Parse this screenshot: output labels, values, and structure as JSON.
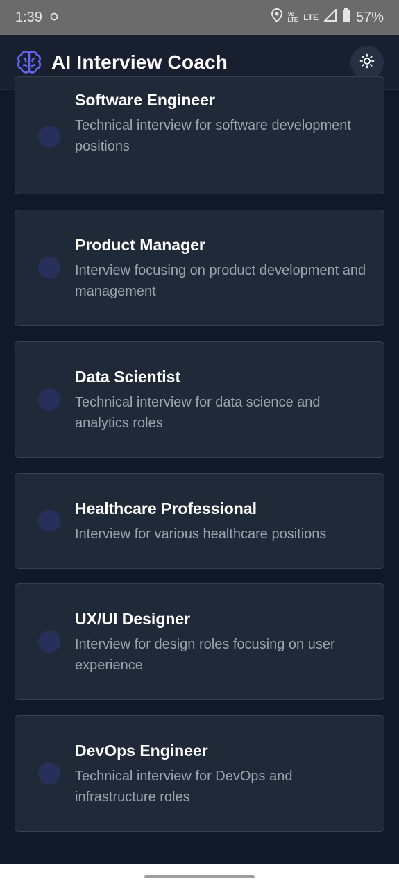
{
  "status_bar": {
    "time": "1:39",
    "network_top": "Vo",
    "network_bottom": "LTE",
    "lte": "LTE",
    "battery": "57%"
  },
  "app_bar": {
    "title": "AI Interview Coach"
  },
  "interviews": [
    {
      "title": "Software Engineer",
      "description": "Technical interview for software development positions"
    },
    {
      "title": "Product Manager",
      "description": "Interview focusing on product development and management"
    },
    {
      "title": "Data Scientist",
      "description": "Technical interview for data science and analytics roles"
    },
    {
      "title": "Healthcare Professional",
      "description": "Interview for various healthcare positions"
    },
    {
      "title": "UX/UI Designer",
      "description": "Interview for design roles focusing on user experience"
    },
    {
      "title": "DevOps Engineer",
      "description": "Technical interview for DevOps and infrastructure roles"
    }
  ],
  "colors": {
    "background": "#111827",
    "card": "#1f2937",
    "accent": "#6366f1",
    "text_muted": "#9ca3af"
  }
}
